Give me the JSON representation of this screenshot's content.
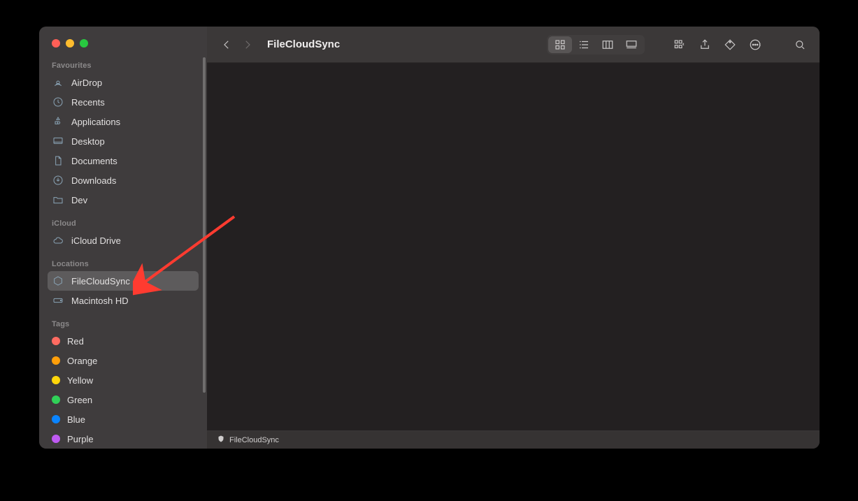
{
  "window_title": "FileCloudSync",
  "sidebar": {
    "sections": [
      {
        "header": "Favourites",
        "items": [
          {
            "icon": "airdrop-icon",
            "label": "AirDrop",
            "selected": false
          },
          {
            "icon": "clock-icon",
            "label": "Recents",
            "selected": false
          },
          {
            "icon": "apps-icon",
            "label": "Applications",
            "selected": false
          },
          {
            "icon": "desktop-icon",
            "label": "Desktop",
            "selected": false
          },
          {
            "icon": "document-icon",
            "label": "Documents",
            "selected": false
          },
          {
            "icon": "downloads-icon",
            "label": "Downloads",
            "selected": false
          },
          {
            "icon": "folder-icon",
            "label": "Dev",
            "selected": false
          }
        ]
      },
      {
        "header": "iCloud",
        "items": [
          {
            "icon": "cloud-icon",
            "label": "iCloud Drive",
            "selected": false
          }
        ]
      },
      {
        "header": "Locations",
        "items": [
          {
            "icon": "hexagon-icon",
            "label": "FileCloudSync",
            "selected": true
          },
          {
            "icon": "disk-icon",
            "label": "Macintosh HD",
            "selected": false
          }
        ]
      },
      {
        "header": "Tags",
        "items": [
          {
            "icon": "tag-dot",
            "label": "Red",
            "color": "#ff6b61",
            "selected": false
          },
          {
            "icon": "tag-dot",
            "label": "Orange",
            "color": "#ff9f0a",
            "selected": false
          },
          {
            "icon": "tag-dot",
            "label": "Yellow",
            "color": "#ffd60a",
            "selected": false
          },
          {
            "icon": "tag-dot",
            "label": "Green",
            "color": "#30d158",
            "selected": false
          },
          {
            "icon": "tag-dot",
            "label": "Blue",
            "color": "#0a84ff",
            "selected": false
          },
          {
            "icon": "tag-dot",
            "label": "Purple",
            "color": "#bf5af2",
            "selected": false
          }
        ]
      }
    ]
  },
  "toolbar": {
    "back_icon": "chevron-left-icon",
    "forward_icon": "chevron-right-icon",
    "view_icons": [
      "grid-icon",
      "list-icon",
      "column-icon",
      "gallery-icon"
    ],
    "active_view": 0,
    "group_icon": "group-icon",
    "share_icon": "share-icon",
    "tag_icon": "tag-icon",
    "more_icon": "ellipsis-icon",
    "search_icon": "search-icon"
  },
  "pathbar": {
    "icon": "shield-icon",
    "label": "FileCloudSync"
  }
}
